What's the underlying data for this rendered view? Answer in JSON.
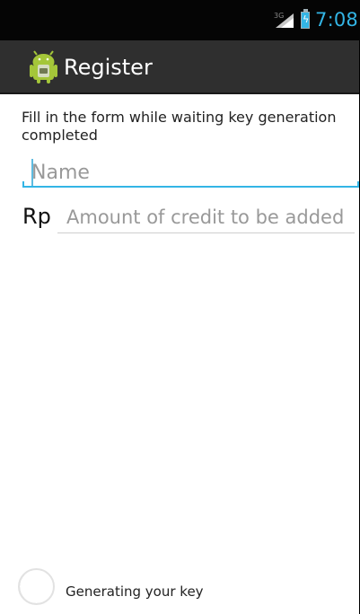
{
  "status_bar": {
    "network_label": "3G",
    "time": "7:08",
    "accent_color": "#33b5e5",
    "icons": [
      "signal-icon",
      "battery-icon"
    ]
  },
  "action_bar": {
    "title": "Register",
    "icon": "android-app-icon",
    "background_color": "#2f2f2f"
  },
  "form": {
    "instruction": "Fill in the form while waiting key generation completed",
    "name": {
      "placeholder": "Name",
      "value": ""
    },
    "credit": {
      "currency": "Rp",
      "placeholder": "Amount of credit to be added",
      "value": ""
    }
  },
  "progress": {
    "label": "Generating your key",
    "icon": "progress-spinner-icon"
  }
}
